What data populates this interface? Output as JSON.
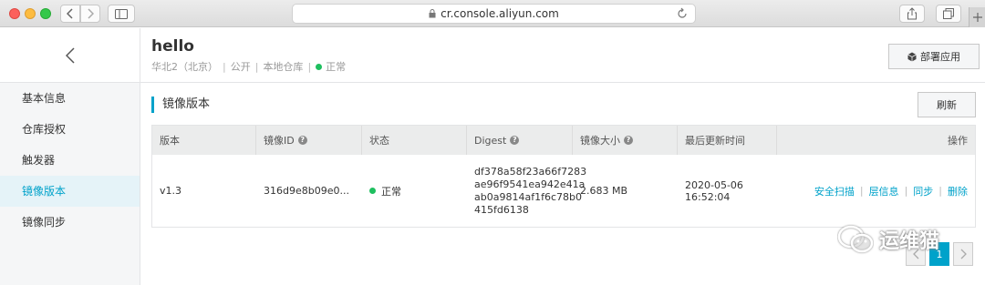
{
  "browser": {
    "url": "cr.console.aliyun.com"
  },
  "sidebar": {
    "items": [
      {
        "label": "基本信息"
      },
      {
        "label": "仓库授权"
      },
      {
        "label": "触发器"
      },
      {
        "label": "镜像版本",
        "active": true
      },
      {
        "label": "镜像同步"
      }
    ]
  },
  "header": {
    "title": "hello",
    "region": "华北2（北京）",
    "visibility": "公开",
    "repo_type": "本地仓库",
    "status": "正常",
    "deploy_label": "部署应用"
  },
  "section": {
    "title": "镜像版本",
    "refresh_label": "刷新"
  },
  "table": {
    "columns": [
      "版本",
      "镜像ID",
      "状态",
      "Digest",
      "镜像大小",
      "最后更新时间",
      "操作"
    ],
    "rows": [
      {
        "version": "v1.3",
        "image_id": "316d9e8b09e0...",
        "status": "正常",
        "digest_lines": [
          "df378a58f23a66f7283",
          "ae96f9541ea942e41a",
          "ab0a9814af1f6c78b0",
          "415fd6138"
        ],
        "size": "2.683 MB",
        "updated": "2020-05-06 16:52:04",
        "actions": [
          "安全扫描",
          "层信息",
          "同步",
          "删除"
        ]
      }
    ]
  },
  "pagination": {
    "current": "1"
  },
  "watermark": {
    "text": "运维猫"
  },
  "colors": {
    "accent": "#00a2ca",
    "status_ok": "#1ebf5f"
  }
}
